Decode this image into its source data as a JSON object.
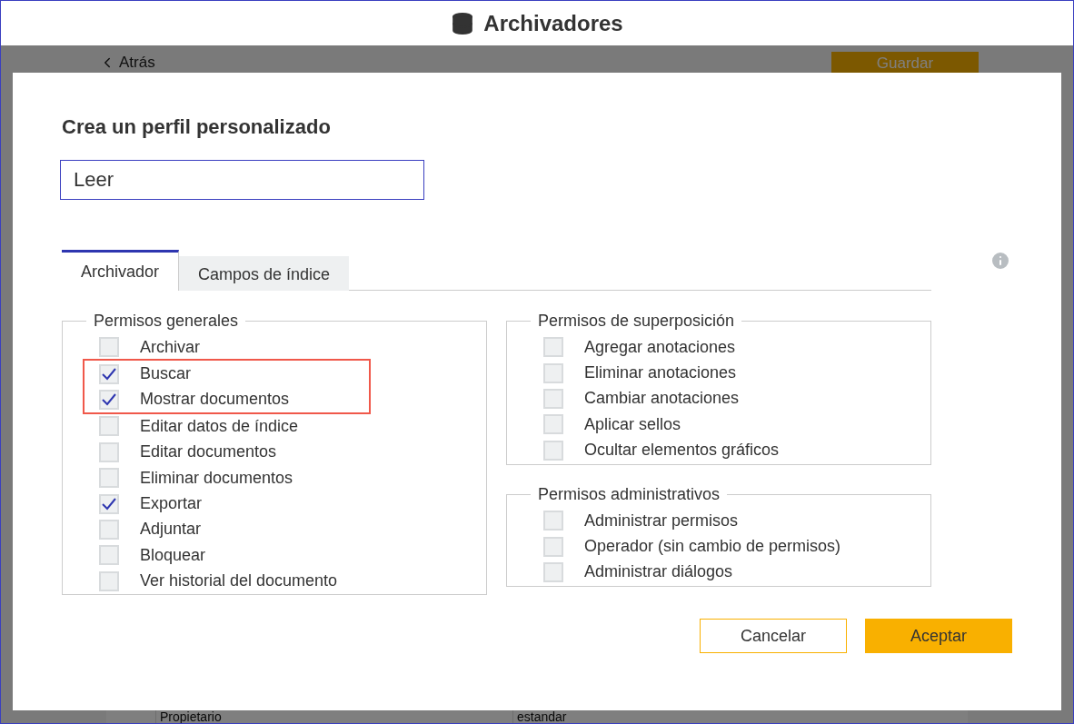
{
  "window": {
    "title": "Archivadores"
  },
  "background": {
    "back_link": "Atrás",
    "save_button": "Guardar",
    "row": [
      "Propietario",
      "estandar"
    ]
  },
  "dialog": {
    "title": "Crea un perfil personalizado",
    "name_field": {
      "value": "Leer"
    },
    "tabs": [
      {
        "label": "Archivador",
        "selected": true
      },
      {
        "label": "Campos de índice",
        "selected": false
      }
    ],
    "columns": [
      {
        "groups": [
          {
            "legend": "Permisos generales",
            "items": [
              {
                "label": "Archivar",
                "checked": false,
                "highlighted": false
              },
              {
                "label": "Buscar",
                "checked": true,
                "highlighted": true
              },
              {
                "label": "Mostrar documentos",
                "checked": true,
                "highlighted": true
              },
              {
                "label": "Editar datos de índice",
                "checked": false,
                "highlighted": false
              },
              {
                "label": "Editar documentos",
                "checked": false,
                "highlighted": false
              },
              {
                "label": "Eliminar documentos",
                "checked": false,
                "highlighted": false
              },
              {
                "label": "Exportar",
                "checked": true,
                "highlighted": false
              },
              {
                "label": "Adjuntar",
                "checked": false,
                "highlighted": false
              },
              {
                "label": "Bloquear",
                "checked": false,
                "highlighted": false
              },
              {
                "label": "Ver historial del documento",
                "checked": false,
                "highlighted": false
              }
            ]
          }
        ]
      },
      {
        "groups": [
          {
            "legend": "Permisos de superposición",
            "items": [
              {
                "label": "Agregar anotaciones",
                "checked": false,
                "highlighted": false
              },
              {
                "label": "Eliminar anotaciones",
                "checked": false,
                "highlighted": false
              },
              {
                "label": "Cambiar anotaciones",
                "checked": false,
                "highlighted": false
              },
              {
                "label": "Aplicar sellos",
                "checked": false,
                "highlighted": false
              },
              {
                "label": "Ocultar elementos gráficos",
                "checked": false,
                "highlighted": false
              }
            ]
          },
          {
            "legend": "Permisos administrativos",
            "items": [
              {
                "label": "Administrar permisos",
                "checked": false,
                "highlighted": false
              },
              {
                "label": "Operador (sin cambio de permisos)",
                "checked": false,
                "highlighted": false
              },
              {
                "label": "Administrar diálogos",
                "checked": false,
                "highlighted": false
              }
            ]
          }
        ]
      }
    ],
    "buttons": [
      {
        "label": "Cancelar",
        "kind": "secondary"
      },
      {
        "label": "Aceptar",
        "kind": "primary"
      }
    ]
  }
}
